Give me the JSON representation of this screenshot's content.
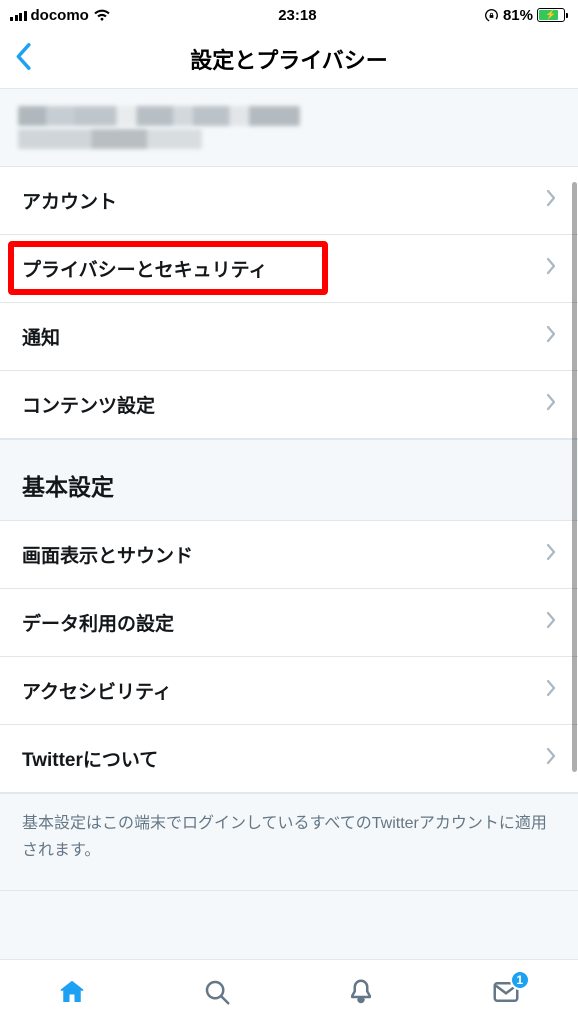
{
  "status": {
    "carrier": "docomo",
    "time": "23:18",
    "battery_pct": "81%"
  },
  "nav": {
    "title": "設定とプライバシー"
  },
  "menu_group_1": [
    {
      "label": "アカウント",
      "highlighted": false
    },
    {
      "label": "プライバシーとセキュリティ",
      "highlighted": true
    },
    {
      "label": "通知",
      "highlighted": false
    },
    {
      "label": "コンテンツ設定",
      "highlighted": false
    }
  ],
  "section_header": "基本設定",
  "menu_group_2": [
    {
      "label": "画面表示とサウンド"
    },
    {
      "label": "データ利用の設定"
    },
    {
      "label": "アクセシビリティ"
    },
    {
      "label": "Twitterについて"
    }
  ],
  "footer_note": "基本設定はこの端末でログインしているすべてのTwitterアカウントに適用されます。",
  "tabbar": {
    "messages_badge": "1"
  }
}
